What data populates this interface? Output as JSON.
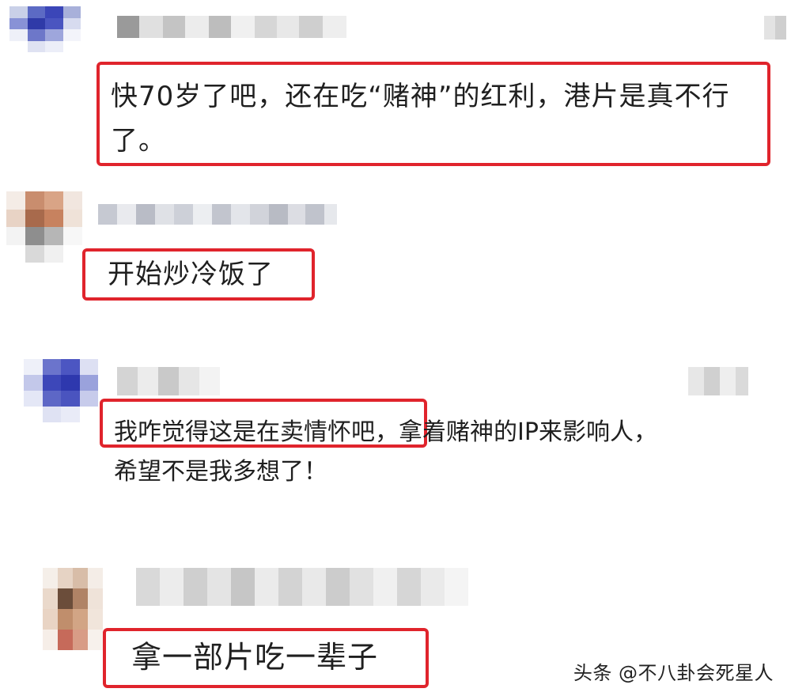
{
  "comments": [
    {
      "line1": "快70岁了吧，还在吃“赌神”的红利，港片是真不行",
      "line2": "了。"
    },
    {
      "line1": "开始炒冷饭了"
    },
    {
      "line1": "我咋觉得这是在卖情怀吧，拿着赌神的IP来影响人，",
      "line2": "希望不是我多想了！"
    },
    {
      "line1": "拿一部片吃一辈子"
    }
  ],
  "watermark": "头条 @不八卦会死星人",
  "colors": {
    "highlight_box": "#e0242c",
    "background": "#ffffff"
  }
}
